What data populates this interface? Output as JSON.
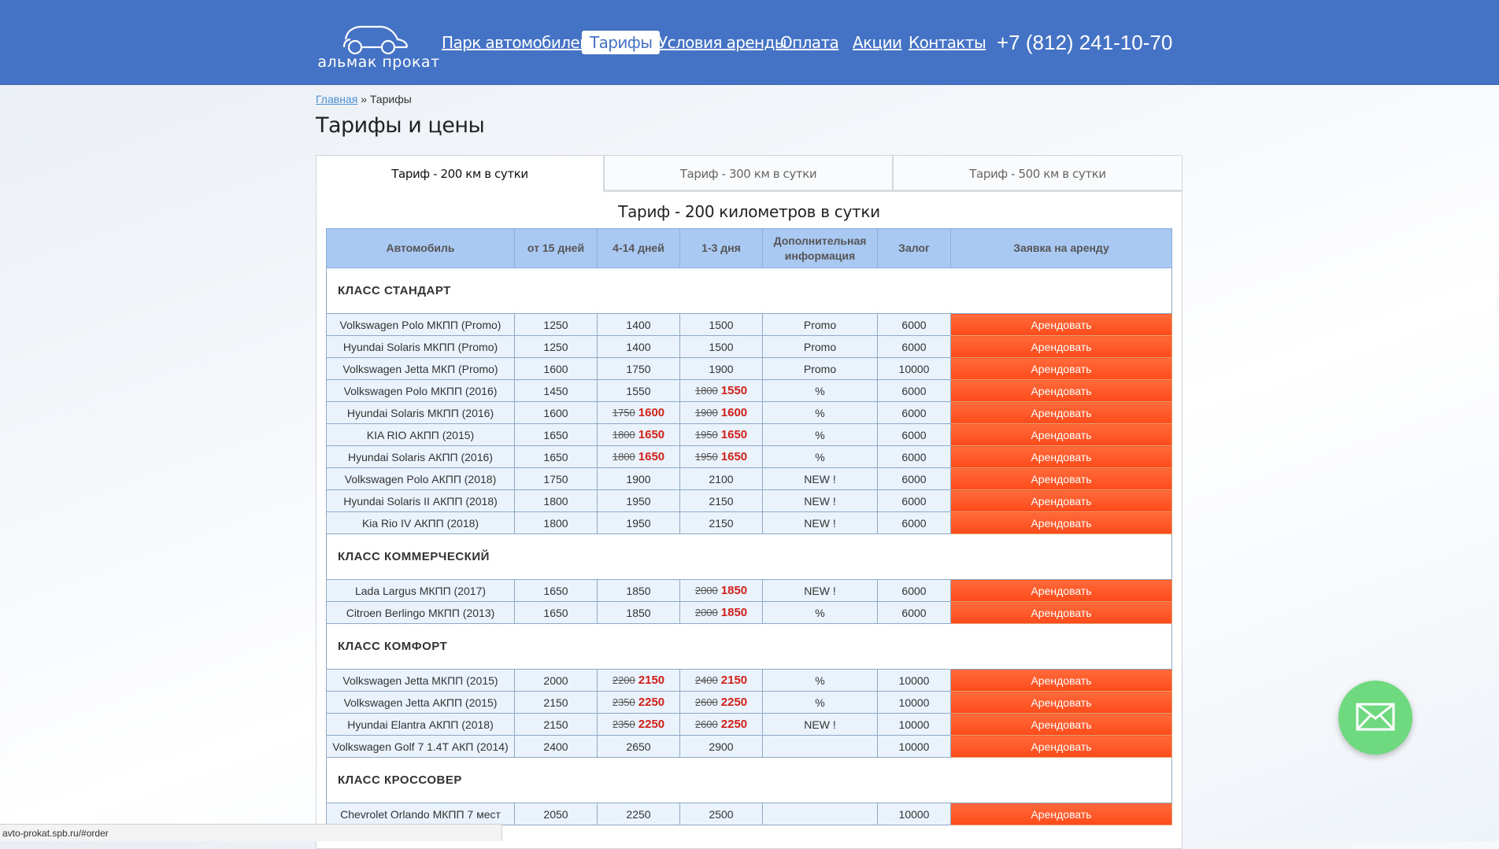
{
  "header": {
    "logo_text": "альмак прокат",
    "nav": [
      {
        "label": "Парк автомобилей",
        "active": false
      },
      {
        "label": "Тарифы",
        "active": true
      },
      {
        "label": "Условия аренды",
        "active": false
      },
      {
        "label": "Оплата",
        "active": false
      },
      {
        "label": "Акции",
        "active": false
      },
      {
        "label": "Контакты",
        "active": false
      }
    ],
    "phone": "+7 (812) 241-10-70"
  },
  "breadcrumb": {
    "home": "Главная",
    "separator": "»",
    "current": "Тарифы"
  },
  "page_title": "Тарифы и цены",
  "tabs": [
    {
      "label": "Тариф - 200 км в сутки",
      "active": true
    },
    {
      "label": "Тариф - 300 км в сутки",
      "active": false
    },
    {
      "label": "Тариф - 500 км в сутки",
      "active": false
    }
  ],
  "table_title": "Тариф - 200 километров в сутки",
  "columns": [
    "Автомобиль",
    "от 15 дней",
    "4-14 дней",
    "1-3 дня",
    "Дополнительная информация",
    "Залог",
    "Заявка на аренду"
  ],
  "rent_label": "Арендовать",
  "sections": [
    {
      "name": "КЛАСС СТАНДАРТ",
      "rows": [
        {
          "car": "Volkswagen Polo МКПП (Promo)",
          "d15": "1250",
          "d4_14": {
            "new": "1400"
          },
          "d1_3": {
            "new": "1500"
          },
          "info": "Promo",
          "deposit": "6000"
        },
        {
          "car": "Hyundai Solaris МКПП (Promo)",
          "d15": "1250",
          "d4_14": {
            "new": "1400"
          },
          "d1_3": {
            "new": "1500"
          },
          "info": "Promo",
          "deposit": "6000"
        },
        {
          "car": "Volkswagen Jetta МКП (Promo)",
          "d15": "1600",
          "d4_14": {
            "new": "1750"
          },
          "d1_3": {
            "new": "1900"
          },
          "info": "Promo",
          "deposit": "10000"
        },
        {
          "car": "Volkswagen Polo МКПП (2016)",
          "d15": "1450",
          "d4_14": {
            "new": "1550"
          },
          "d1_3": {
            "old": "1800",
            "new": "1550"
          },
          "info": "%",
          "deposit": "6000"
        },
        {
          "car": "Hyundai Solaris МКПП (2016)",
          "d15": "1600",
          "d4_14": {
            "old": "1750",
            "new": "1600"
          },
          "d1_3": {
            "old": "1900",
            "new": "1600"
          },
          "info": "%",
          "deposit": "6000"
        },
        {
          "car": "KIA RIO АКПП (2015)",
          "d15": "1650",
          "d4_14": {
            "old": "1800",
            "new": "1650"
          },
          "d1_3": {
            "old": "1950",
            "new": "1650"
          },
          "info": "%",
          "deposit": "6000"
        },
        {
          "car": "Hyundai Solaris АКПП (2016)",
          "d15": "1650",
          "d4_14": {
            "old": "1800",
            "new": "1650"
          },
          "d1_3": {
            "old": "1950",
            "new": "1650"
          },
          "info": "%",
          "deposit": "6000"
        },
        {
          "car": "Volkswagen Polo АКПП (2018)",
          "d15": "1750",
          "d4_14": {
            "new": "1900"
          },
          "d1_3": {
            "new": "2100"
          },
          "info": "NEW !",
          "deposit": "6000"
        },
        {
          "car": "Hyundai Solaris II АКПП (2018)",
          "d15": "1800",
          "d4_14": {
            "new": "1950"
          },
          "d1_3": {
            "new": "2150"
          },
          "info": "NEW !",
          "deposit": "6000"
        },
        {
          "car": "Kia Rio IV АКПП (2018)",
          "d15": "1800",
          "d4_14": {
            "new": "1950"
          },
          "d1_3": {
            "new": "2150"
          },
          "info": "NEW !",
          "deposit": "6000"
        }
      ]
    },
    {
      "name": "КЛАСС КОММЕРЧЕСКИЙ",
      "rows": [
        {
          "car": "Lada Largus МКПП (2017)",
          "d15": "1650",
          "d4_14": {
            "new": "1850"
          },
          "d1_3": {
            "old": "2000",
            "new": "1850"
          },
          "info": "NEW !",
          "deposit": "6000"
        },
        {
          "car": "Citroen Berlingo МКПП (2013)",
          "d15": "1650",
          "d4_14": {
            "new": "1850"
          },
          "d1_3": {
            "old": "2000",
            "new": "1850"
          },
          "info": "%",
          "deposit": "6000"
        }
      ]
    },
    {
      "name": "КЛАСС КОМФОРТ",
      "rows": [
        {
          "car": "Volkswagen Jetta МКПП (2015)",
          "d15": "2000",
          "d4_14": {
            "old": "2200",
            "new": "2150"
          },
          "d1_3": {
            "old": "2400",
            "new": "2150"
          },
          "info": "%",
          "deposit": "10000"
        },
        {
          "car": "Volkswagen Jetta АКПП (2015)",
          "d15": "2150",
          "d4_14": {
            "old": "2350",
            "new": "2250"
          },
          "d1_3": {
            "old": "2600",
            "new": "2250"
          },
          "info": "%",
          "deposit": "10000"
        },
        {
          "car": "Hyundai Elantra АКПП (2018)",
          "d15": "2150",
          "d4_14": {
            "old": "2350",
            "new": "2250"
          },
          "d1_3": {
            "old": "2600",
            "new": "2250"
          },
          "info": "NEW !",
          "deposit": "10000"
        },
        {
          "car": "Volkswagen Golf 7 1.4T АКП (2014)",
          "d15": "2400",
          "d4_14": {
            "new": "2650"
          },
          "d1_3": {
            "new": "2900"
          },
          "info": "",
          "deposit": "10000"
        }
      ]
    },
    {
      "name": "КЛАСС КРОССОВЕР",
      "rows": [
        {
          "car": "Chevrolet Orlando МКПП 7 мест",
          "d15": "2050",
          "d4_14": {
            "new": "2250"
          },
          "d1_3": {
            "new": "2500"
          },
          "info": "",
          "deposit": "10000"
        }
      ]
    }
  ],
  "status_url": "avto-prokat.spb.ru/#order"
}
